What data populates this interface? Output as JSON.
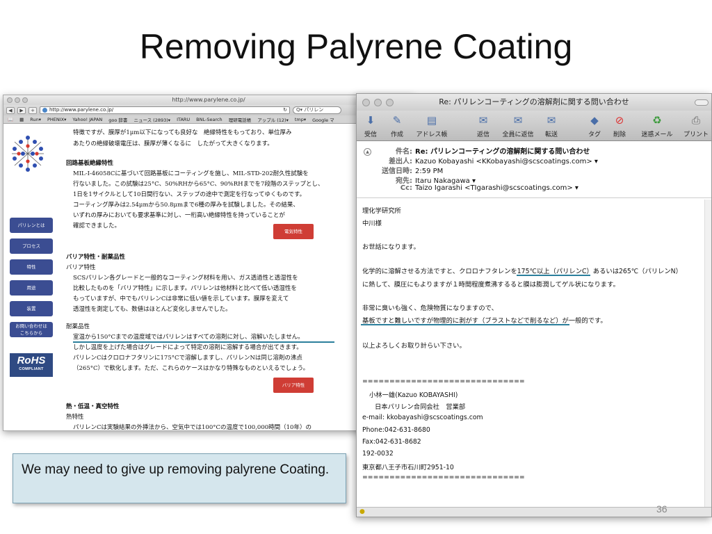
{
  "slide": {
    "title": "Removing Palyrene Coating",
    "callout": "We may need to give up removing palyrene Coating.",
    "page_number": "36"
  },
  "browser": {
    "title": "http://www.parylene.co.jp/",
    "url": "http://www.parylene.co.jp/",
    "search": "Q▾ パリレン",
    "reload_icon": "reload-icon",
    "bookmarks": [
      "Run▾",
      "PHENIX▾",
      "Yahoo! JAPAN",
      "goo 辞書",
      "ニュース (2893)▾",
      "ITARU",
      "BNL-Search",
      "理研電話帳",
      "アップル (12)▾",
      "tmp▾",
      "Google マ"
    ],
    "side_nav": [
      "パリレンとは",
      "プロセス",
      "特性",
      "用途",
      "装置",
      "お問い合わせは",
      "こちらから"
    ],
    "rohs": {
      "line1": "RoHS",
      "line2": "COMPLIANT"
    },
    "lines": [
      "特徴ですが、膜厚が1μm以下になっても良好な　絶縁特性をもっており、単位厚み",
      "あたりの絶縁破壊電圧は、膜厚が薄くなるに　したがって大きくなります。",
      "回路基板絶縁特性",
      "MIL-I-46058Cに基づいて回路基板にコーティングを施し、MIL-STD-202耐久性試験を",
      "行ないました。この試験は25°C、50%RHから65°C、90%RHまでを7段階のステップとし、",
      "1日を1サイクルとして10日間行ない、ステップの途中で測定を行なってゆくものです。",
      "コーティング厚みは2.54μmから50.8μmまで6種の厚みを試験しました。その結果、",
      "いずれの厚みにおいても要求基準に対し、一桁高い絶縁特性を持っていることが",
      "確認できました。",
      "バリア特性・耐薬品性",
      "バリア特性",
      "SCSパリレン各グレードと一般的なコーティング材料を用い、ガス透過性と透湿性を",
      "比較したものを「バリア特性」に示します。パリレンは他材料と比べて低い透湿性を",
      "もっていますが、中でもパリレンCは非常に低い値を示しています。膜厚を変えて",
      "透湿性を測定しても、数値はほとんど変化しませんでした。",
      "耐薬品性",
      "室温から150°Cまでの温度域ではパリレンはすべての溶剤に対し、溶解いたしません。",
      "しかし温度を上げた場合はグレードによって特定の溶剤に溶解する場合が出てきます。",
      "パリレンCはクロロナフタリンに175°Cで溶解しますし、パリレンNは同じ溶剤の沸点",
      "（265°C）で軟化します。ただ、これらのケースはかなり特殊なものといえるでしょう。",
      "熱・低温・真空特性",
      "熱特性",
      "パリレンCは実験結果の外挿法から、空気中では100°Cの温度で100,000時間（10年）の"
    ],
    "button_electrical": "電気特性",
    "button_barrier": "バリア特性"
  },
  "mail": {
    "title": "Re: パリレンコーティングの溶解剤に関する問い合わせ",
    "toolbar": [
      "受信",
      "作成",
      "アドレス帳",
      "返信",
      "全員に返信",
      "転送",
      "タグ",
      "削除",
      "迷惑メール",
      "プリント"
    ],
    "header": {
      "subject_label": "件名:",
      "subject": "Re: パリレンコーティングの溶解剤に関する問い合わせ",
      "from_label": "差出人:",
      "from": "Kazuo Kobayashi <KKobayashi@scscoatings.com> ▾",
      "date_label": "送信日時:",
      "date": "2:59 PM",
      "to_label": "宛先:",
      "to": "Itaru Nakagawa ▾",
      "cc_label": "Cc:",
      "cc": "Taizo Igarashi <TIgarashi@scscoatings.com> ▾"
    },
    "body": [
      "理化学研究所",
      "中川様",
      "お世話になります。",
      "化学的に溶解させる方法ですと、クロロナフタレンを175℃以上（パリレンC）あるいは265℃（パリレンN）",
      "に熱して、膜圧にもよりますが１時間程度煮沸するると膜は膨潤してゲル状になります。",
      "非常に臭いも強く、危険物質になりますので、",
      "基板ですと難しいですが物理的に剥がす（ブラストなどで削るなど）が一般的です。",
      "以上よろしくお取り計らい下さい。",
      "==============================",
      "小林一雄(Kazuo KOBAYASHI)",
      "日本パリレン合同会社　営業部",
      "e-mail: kkobayashi@scscoatings.com",
      "Phone:042-631-8680",
      "Fax:042-631-8682",
      "192-0032",
      "東京都八王子市石川町2951-10",
      "=============================="
    ]
  },
  "colors": {
    "nav_blue": "#3b4d92",
    "button_red": "#cf3d35",
    "underline_teal": "#2b7f9c",
    "callout_bg": "#d5e6ed"
  }
}
